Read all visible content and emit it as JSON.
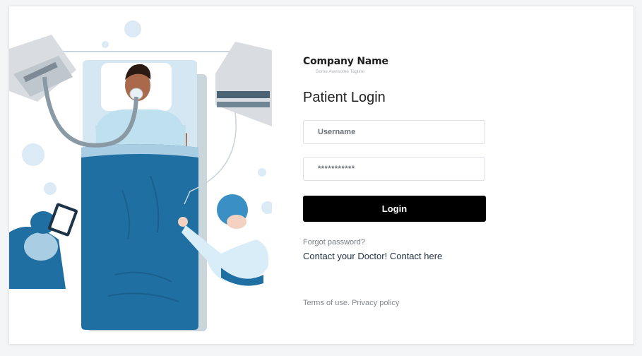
{
  "brand": {
    "name": "Company Name",
    "tagline": "Some Awesome Tagline"
  },
  "login": {
    "title": "Patient Login",
    "username_placeholder": "Username",
    "password_value": "***********",
    "button_label": "Login",
    "forgot_password": "Forgot password?",
    "contact_prefix": "Contact your Doctor!",
    "contact_link": "Contact here"
  },
  "footer": {
    "terms": "Terms of use.",
    "privacy": "Privacy policy"
  },
  "illustration": {
    "icon": "hospital-patient-illustration"
  },
  "colors": {
    "primary_button": "#000000",
    "bed_blue": "#1f6fa3",
    "light_blue": "#cfe6f3"
  }
}
